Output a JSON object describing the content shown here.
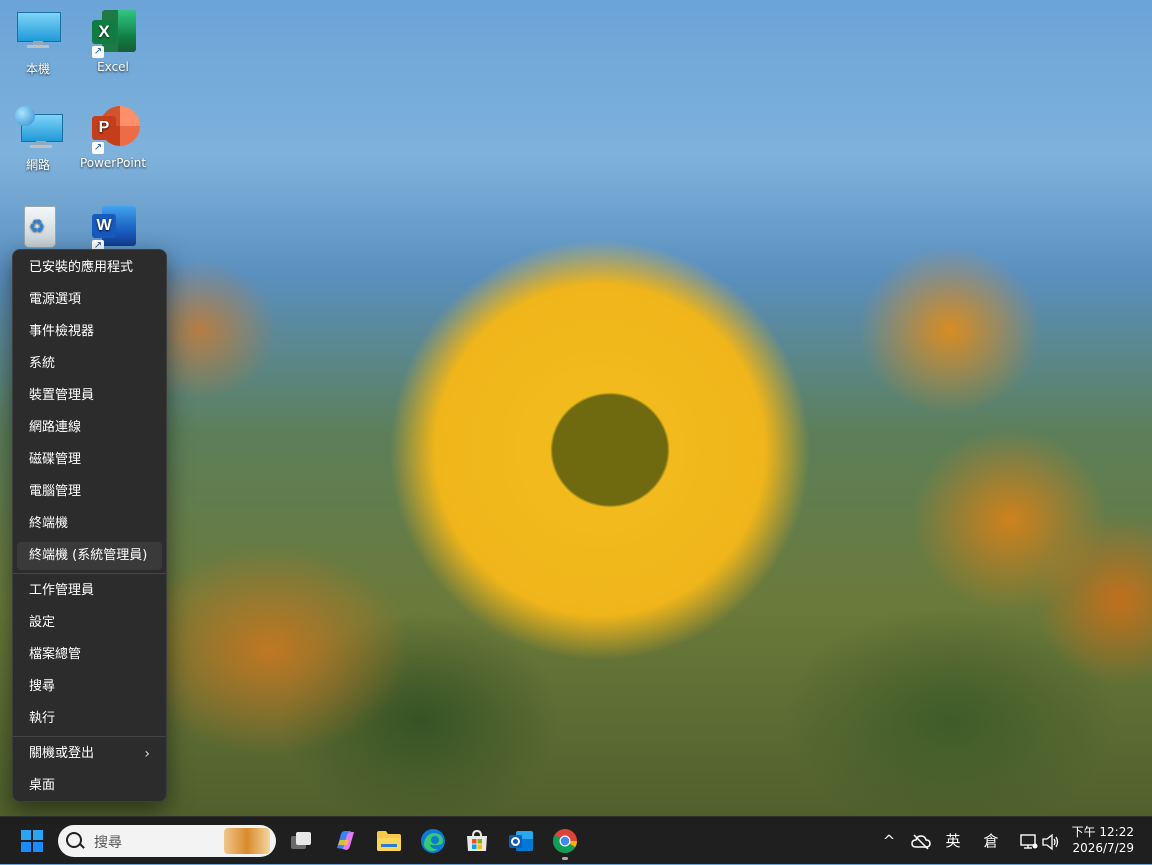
{
  "desktop": {
    "icons": [
      {
        "label": "本機"
      },
      {
        "label": "Excel"
      },
      {
        "label": "網路"
      },
      {
        "label": "PowerPoint"
      },
      {
        "label": ""
      },
      {
        "label": ""
      }
    ]
  },
  "context_menu": {
    "items": [
      {
        "label": "已安裝的應用程式"
      },
      {
        "label": "電源選項"
      },
      {
        "label": "事件檢視器"
      },
      {
        "label": "系統"
      },
      {
        "label": "裝置管理員"
      },
      {
        "label": "網路連線"
      },
      {
        "label": "磁碟管理"
      },
      {
        "label": "電腦管理"
      },
      {
        "label": "終端機"
      },
      {
        "label": "終端機 (系統管理員)"
      },
      {
        "label": "工作管理員"
      },
      {
        "label": "設定"
      },
      {
        "label": "檔案總管"
      },
      {
        "label": "搜尋"
      },
      {
        "label": "執行"
      },
      {
        "label": "關機或登出"
      },
      {
        "label": "桌面"
      }
    ],
    "submenu_indicator": "›"
  },
  "taskbar": {
    "search_placeholder": "搜尋",
    "tray": {
      "chevron": "^",
      "ime_language": "英",
      "ime_mode": "倉"
    },
    "clock": {
      "time": "下午 12:22",
      "date": "2026/7/29"
    }
  },
  "colors": {
    "menu_bg": "#2c2c2c",
    "taskbar_bg": "#1f1f1f",
    "accent_windows": "#1a8cff"
  }
}
